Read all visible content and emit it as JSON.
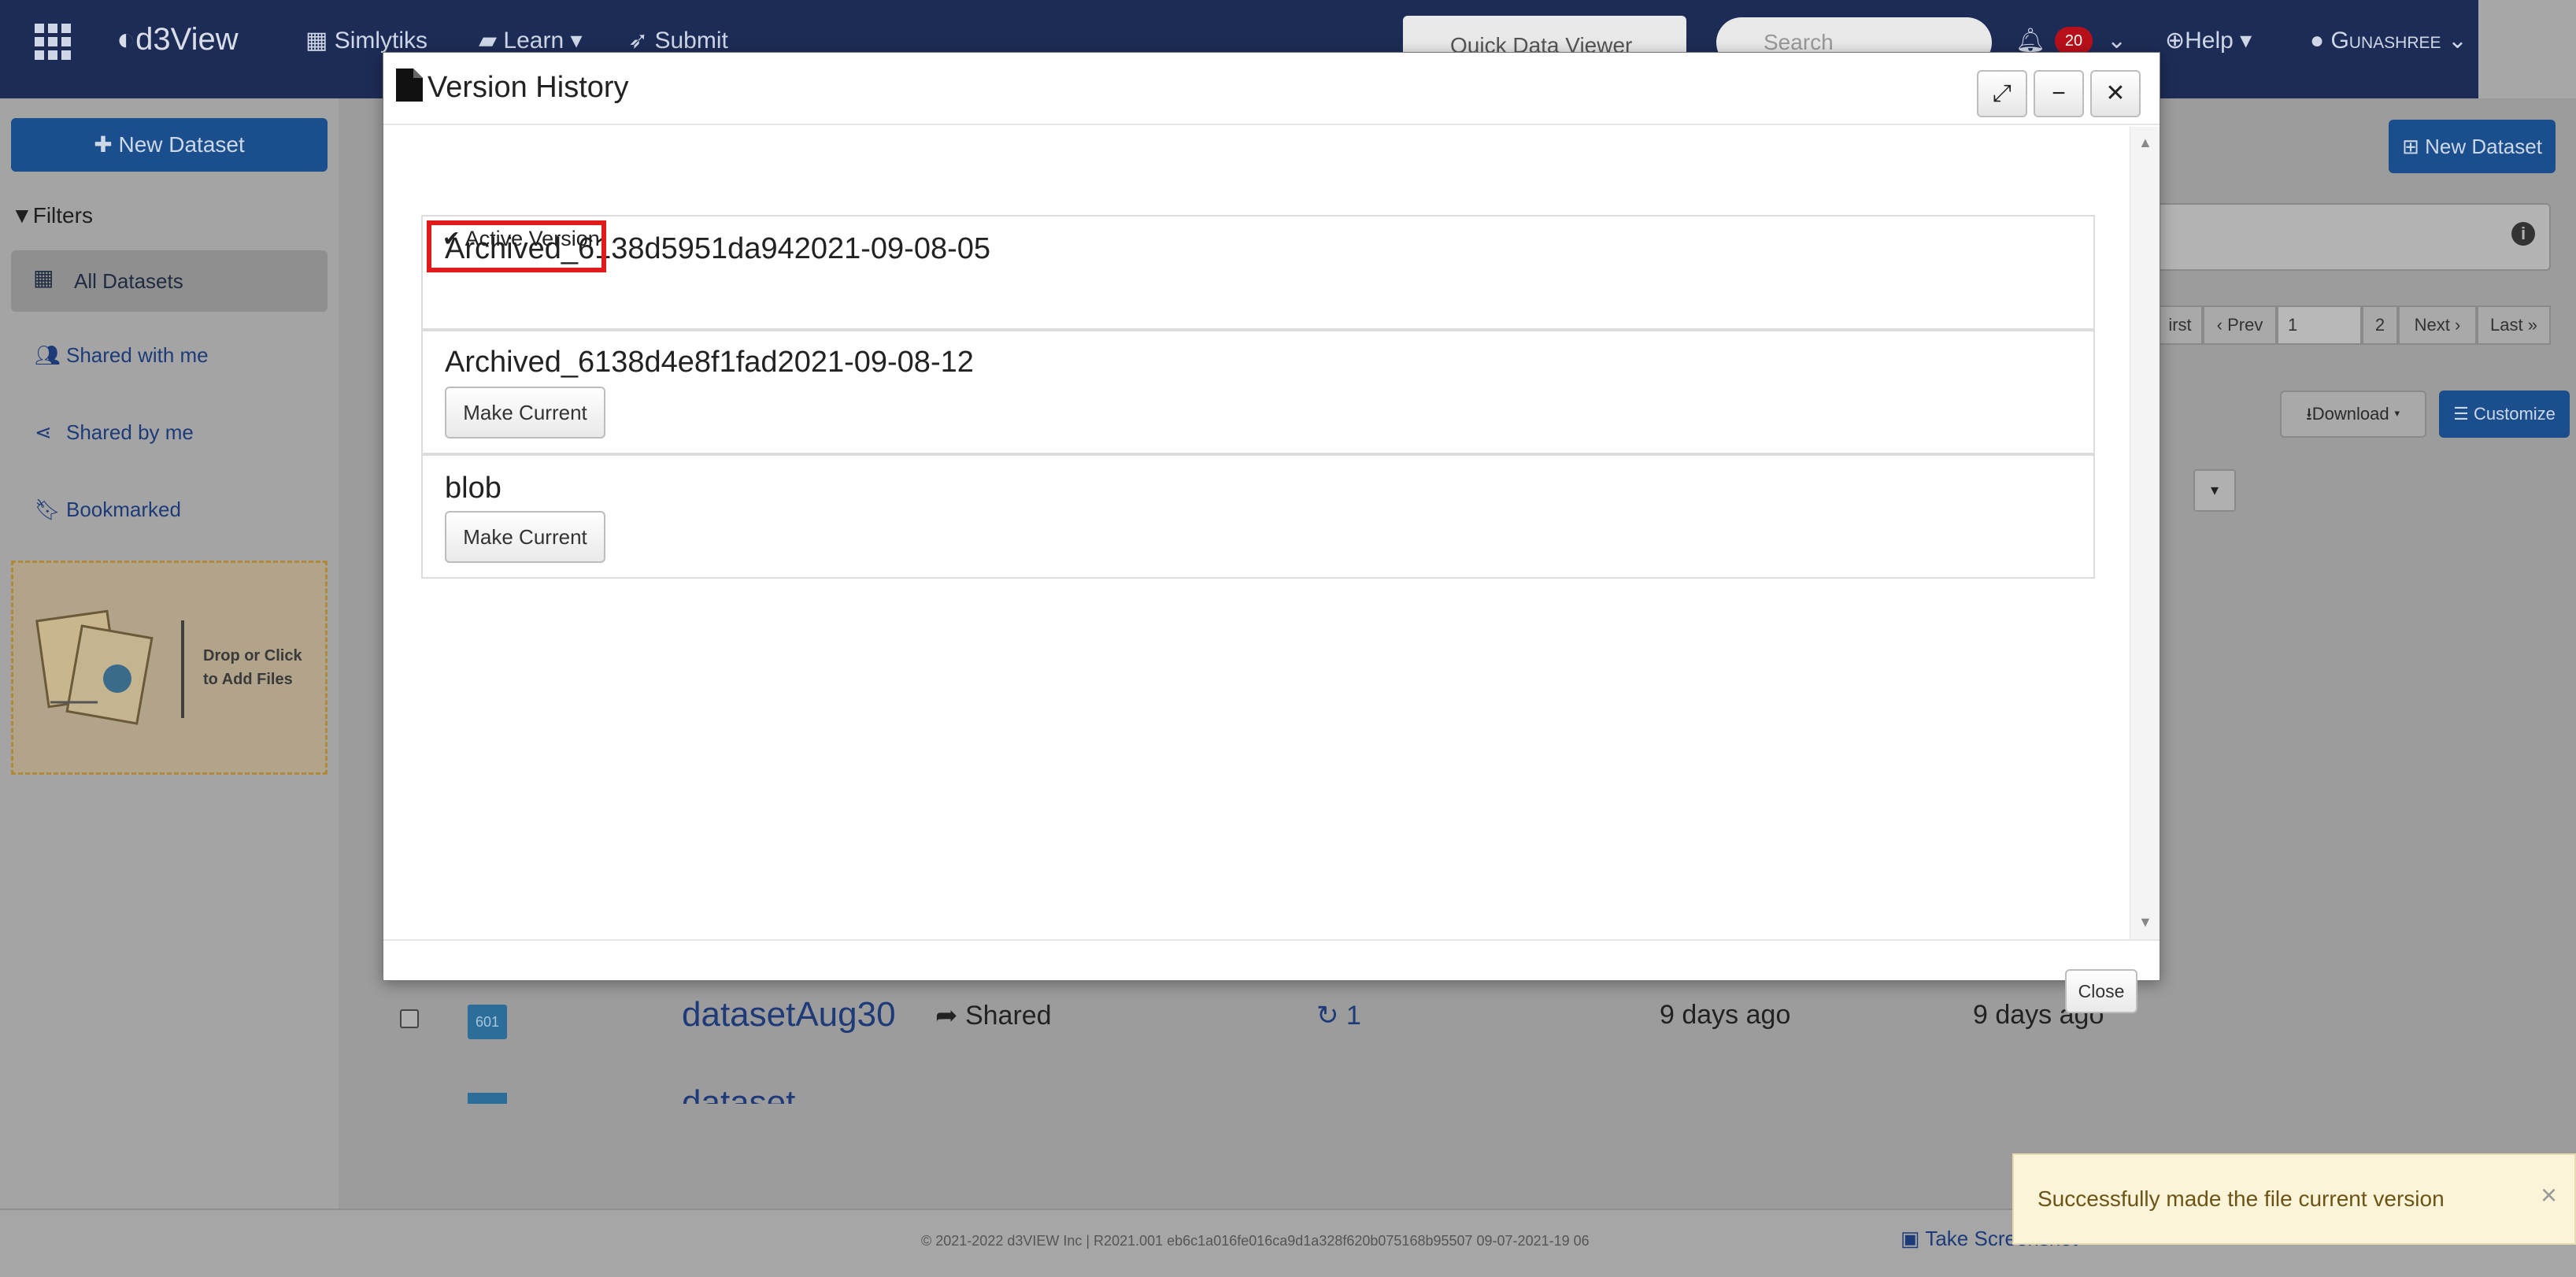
{
  "navbar": {
    "brand": "d3View",
    "items": [
      {
        "label": "Simlytiks",
        "icon": "simlytiks-icon"
      },
      {
        "label": "Learn",
        "icon": "book-icon"
      },
      {
        "label": "Submit",
        "icon": "rocket-icon"
      }
    ],
    "quick_data_viewer": "Quick Data Viewer",
    "search_placeholder": "Search",
    "notification_count": "20",
    "help_label": "Help",
    "user_label": "Gunashree"
  },
  "sidebar": {
    "new_dataset_label": "New Dataset",
    "filters_label": "Filters",
    "items": [
      {
        "label": "All Datasets",
        "icon": "grid-icon"
      },
      {
        "label": "Shared with me",
        "icon": "users-icon"
      },
      {
        "label": "Shared by me",
        "icon": "share-icon"
      },
      {
        "label": "Bookmarked",
        "icon": "bookmark-icon"
      }
    ],
    "dropzone_text_line1": "Drop or Click",
    "dropzone_text_line2": "to Add Files"
  },
  "main": {
    "new_dataset_label": "New Dataset",
    "pager": {
      "first": "irst",
      "prev": "‹ Prev",
      "page_value": "1",
      "page_count": "2",
      "next": "Next ›",
      "last": "Last »"
    },
    "download_label": "Download",
    "customize_label": "Customize",
    "row": {
      "badge": "601",
      "name": "datasetAug30",
      "sharing": "Shared",
      "versions": "1",
      "created": "9 days ago",
      "modified": "9 days ago"
    },
    "row2_name": "dataset"
  },
  "modal": {
    "title": "Version History",
    "versions": [
      {
        "name": "Archived_6138d5951da942021-09-08-05",
        "status": "Active Version"
      },
      {
        "name": "Archived_6138d4e8f1fad2021-09-08-12",
        "action": "Make Current"
      },
      {
        "name": "blob",
        "action": "Make Current"
      }
    ],
    "close_label": "Close",
    "expand_symbol": "⤢",
    "minimize_symbol": "−",
    "close_symbol": "✕"
  },
  "footer": {
    "copyright": "© 2021-2022 d3VIEW Inc | R2021.001 eb6c1a016fe016ca9d1a328f620b075168b95507 09-07-2021-19 06",
    "take_screenshot": "Take Screenshot"
  },
  "toast": {
    "message": "Successfully made the file current version",
    "close_symbol": "×"
  },
  "colors": {
    "navbar": "#1d2c57",
    "primary_button": "#1b4e8c",
    "highlight_box": "#e11b1b",
    "toast_bg": "#fbf4d9"
  }
}
